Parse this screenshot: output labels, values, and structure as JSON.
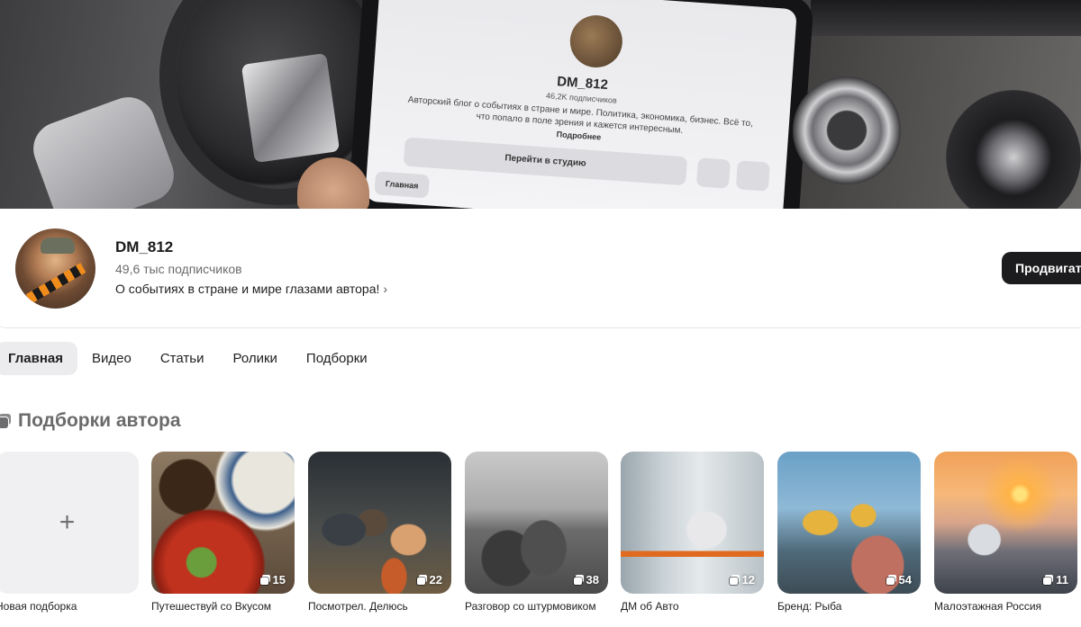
{
  "banner": {
    "tablet_name": "DM_812",
    "tablet_subs": "46,2K подписчиков",
    "tablet_desc": "Авторский блог о событиях в стране и мире. Политика, экономика, бизнес. Всё то, что попало в поле зрения и кажется интересным.",
    "tablet_more": "Подробнее",
    "tablet_studio": "Перейти в студию",
    "tablet_tab": "Главная"
  },
  "channel": {
    "name": "DM_812",
    "subscribers": "49,6 тыс подписчиков",
    "description": "О событиях в стране и мире глазами автора!",
    "promote_label": "Продвигать"
  },
  "tabs": [
    {
      "label": "Главная",
      "active": true
    },
    {
      "label": "Видео",
      "active": false
    },
    {
      "label": "Статьи",
      "active": false
    },
    {
      "label": "Ролики",
      "active": false
    },
    {
      "label": "Подборки",
      "active": false
    }
  ],
  "section": {
    "title": "Подборки автора",
    "icon": "collection-stack-icon"
  },
  "collections": [
    {
      "title": "Новая подборка",
      "count": "",
      "kind": "new"
    },
    {
      "title": "Путешествуй со Вкусом",
      "count": "15",
      "kind": "food"
    },
    {
      "title": "Посмотрел. Делюсь",
      "count": "22",
      "kind": "figures"
    },
    {
      "title": "Разговор со штурмовиком",
      "count": "38",
      "kind": "tank"
    },
    {
      "title": "ДМ об Авто",
      "count": "12",
      "kind": "auto"
    },
    {
      "title": "Бренд: Рыба",
      "count": "54",
      "kind": "fish"
    },
    {
      "title": "Малоэтажная Россия",
      "count": "11",
      "kind": "russia"
    }
  ],
  "colors": {
    "accent_dark": "#1c1c1e",
    "active_tab_bg": "#ececee",
    "muted_text": "#6b6b6b"
  }
}
